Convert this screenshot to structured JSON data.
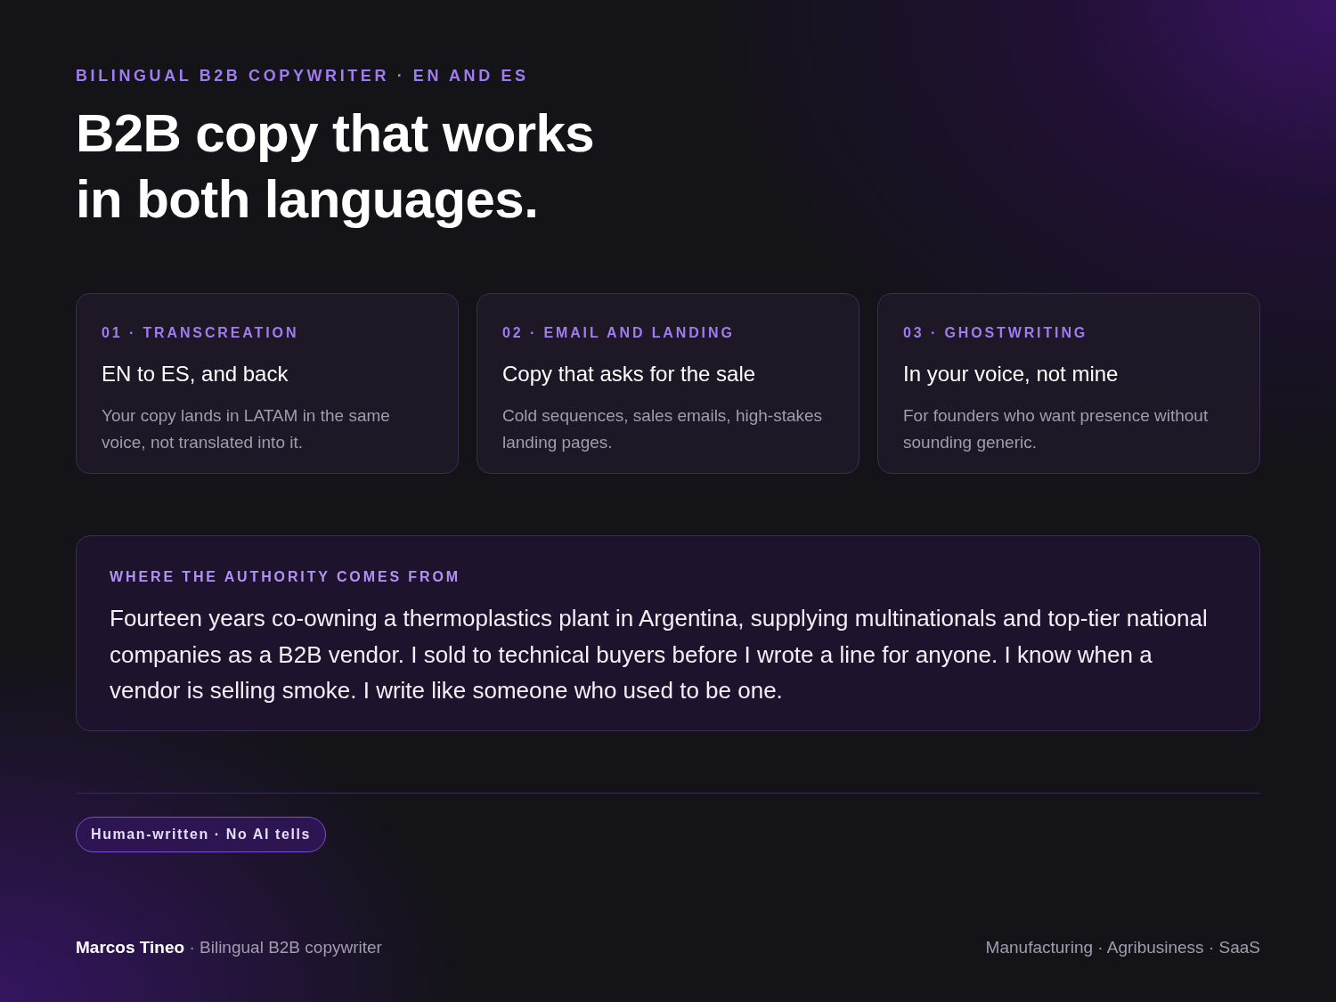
{
  "eyebrow": "BILINGUAL B2B COPYWRITER · EN AND ES",
  "headline": [
    "B2B copy that works",
    "in both languages."
  ],
  "services": [
    {
      "label": "01 · TRANSCREATION",
      "title": "EN to ES, and back",
      "body": "Your copy lands in LATAM in the same voice, not translated into it."
    },
    {
      "label": "02 · EMAIL AND LANDING",
      "title": "Copy that asks for the sale",
      "body": "Cold sequences, sales emails, high-stakes landing pages."
    },
    {
      "label": "03 · GHOSTWRITING",
      "title": "In your voice, not mine",
      "body": "For founders who want presence without sounding generic."
    }
  ],
  "authority": {
    "label": "WHERE THE AUTHORITY COMES FROM",
    "body": "Fourteen years co-owning a thermoplastics plant in Argentina, supplying multinationals and top-tier national companies as a B2B vendor. I sold to technical buyers before I wrote a line for anyone. I know when a vendor is selling smoke. I write like someone who used to be one."
  },
  "badge": "Human-written · No AI tells",
  "footer": {
    "byline": "**Marcos Tineo** · Bilingual B2B copywriter",
    "sectors": "Manufacturing · Agribusiness · SaaS"
  }
}
